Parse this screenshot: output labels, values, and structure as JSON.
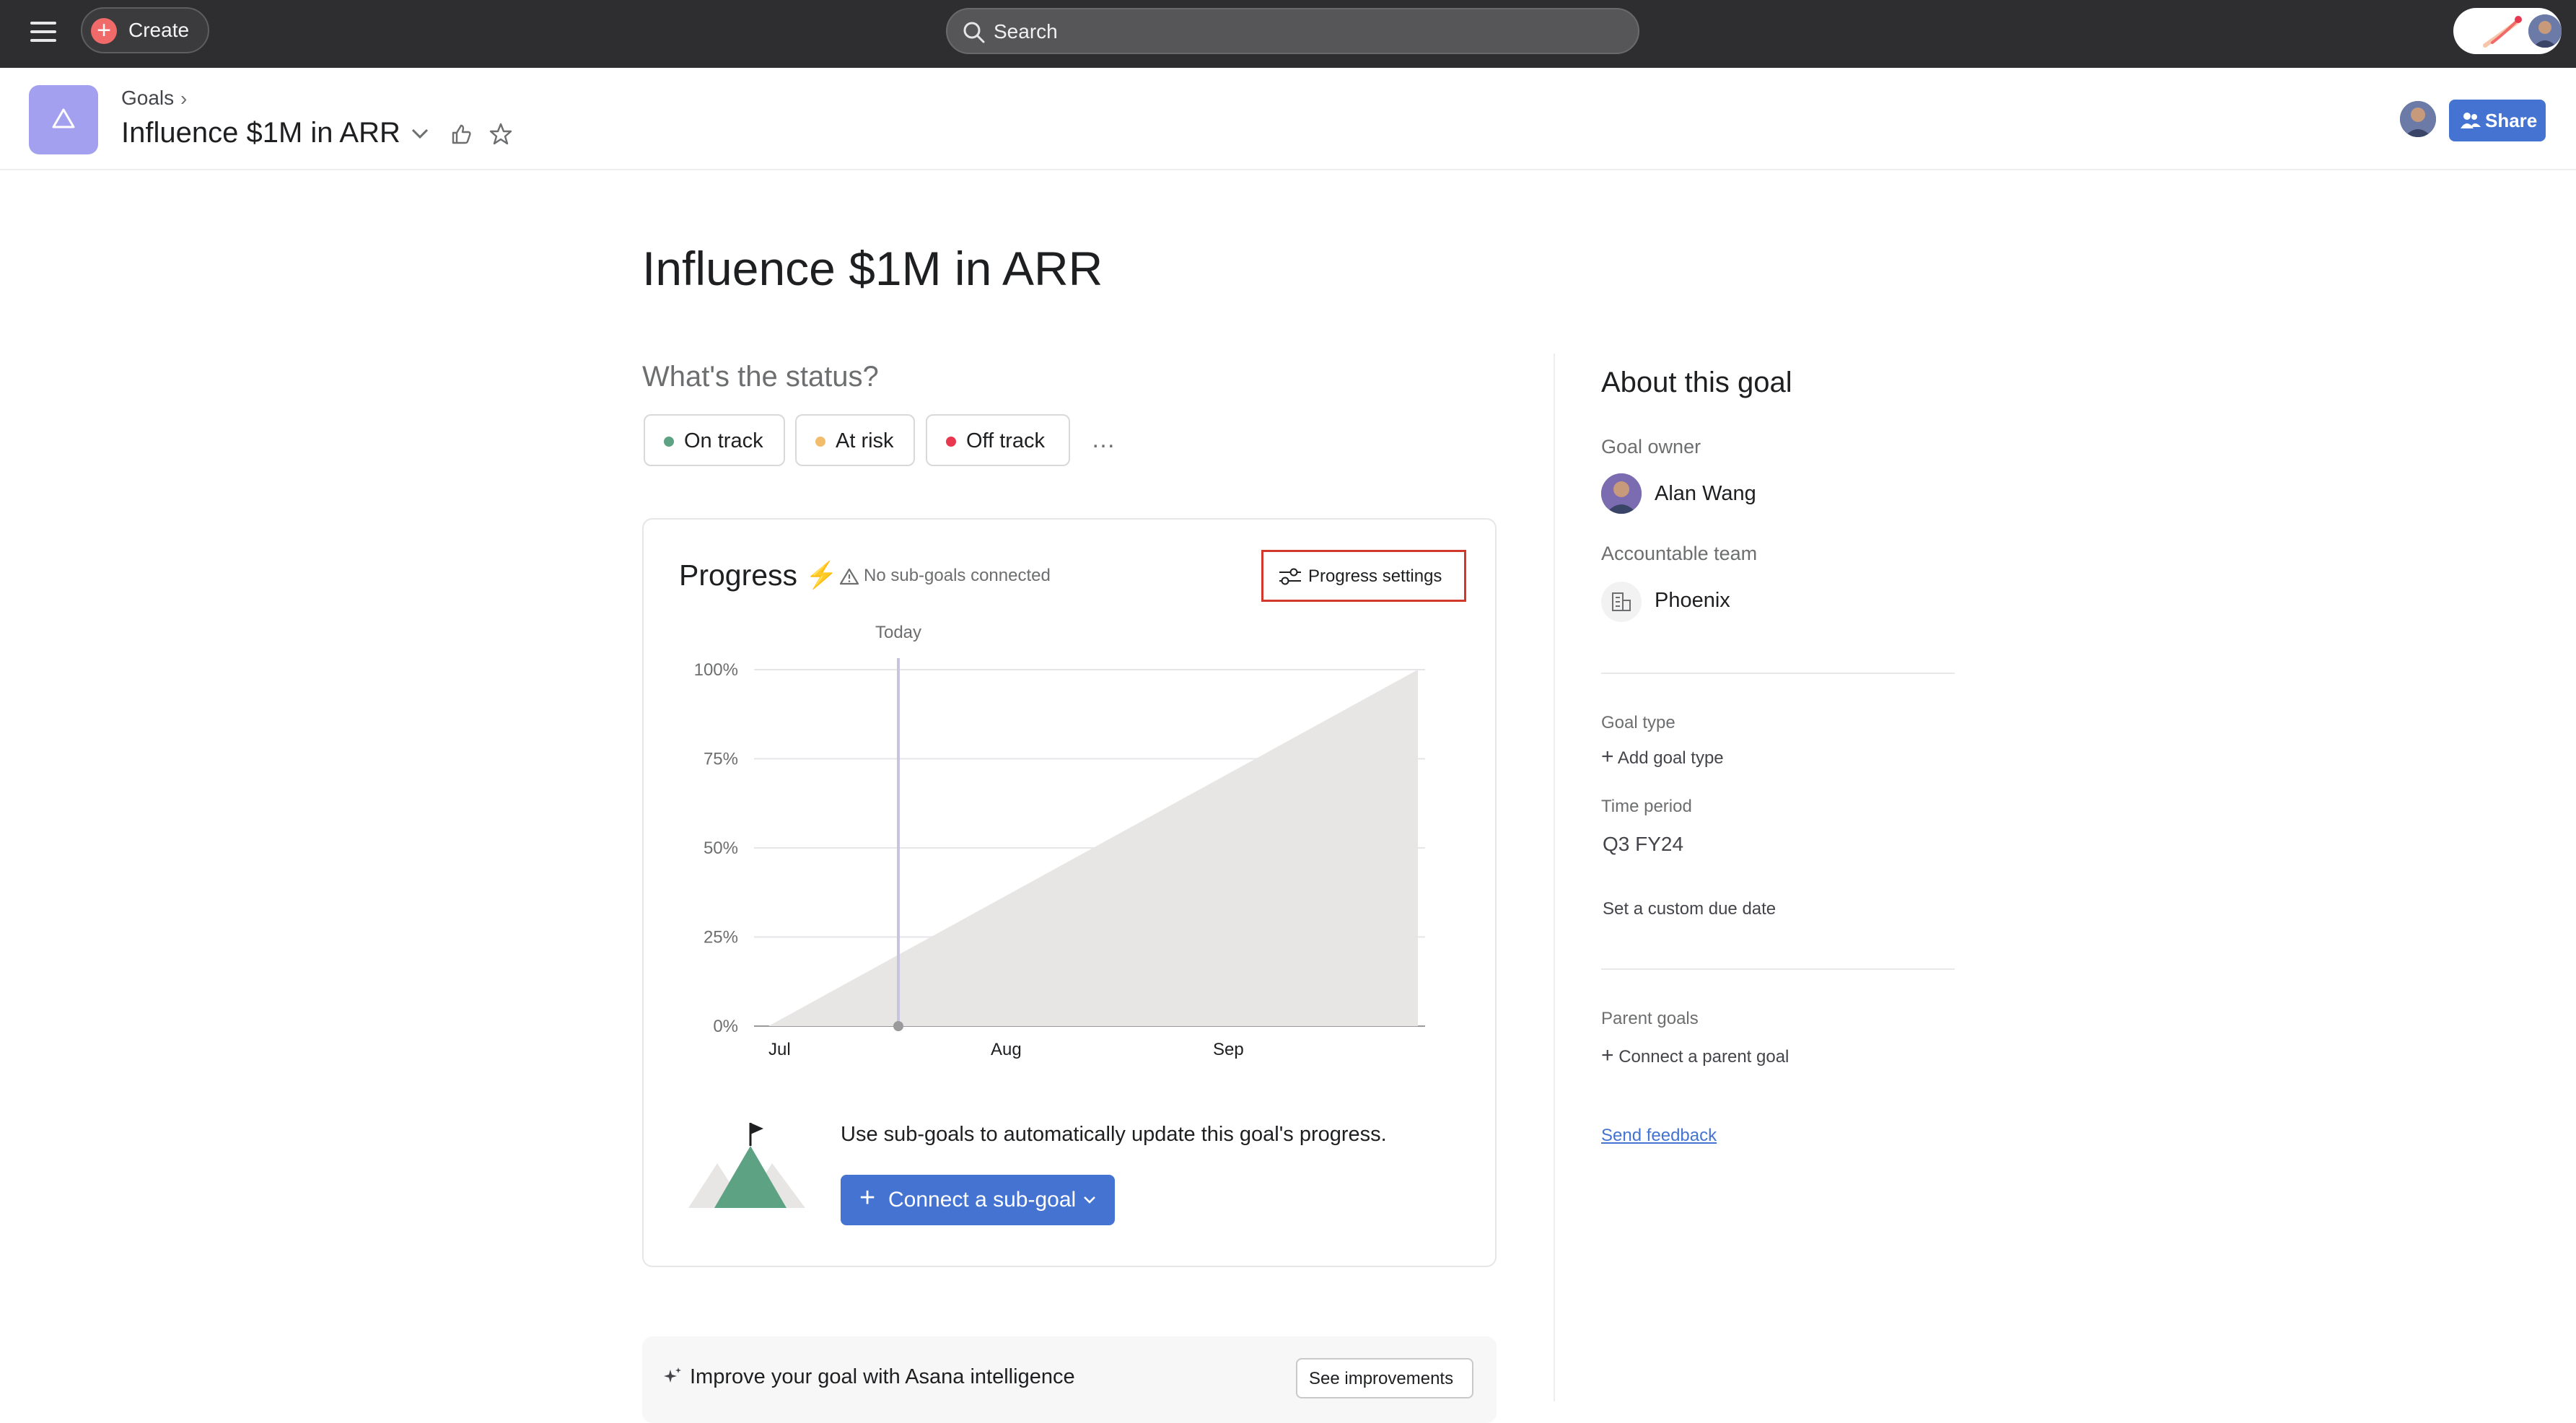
{
  "topbar": {
    "create_label": "Create",
    "search_placeholder": "Search"
  },
  "header": {
    "breadcrumb": "Goals",
    "title": "Influence $1M in ARR",
    "share_label": "Share"
  },
  "main": {
    "title": "Influence $1M in ARR",
    "status_question": "What's the status?",
    "status_options": [
      {
        "label": "On track",
        "color": "#5da283"
      },
      {
        "label": "At risk",
        "color": "#f1bd6c"
      },
      {
        "label": "Off track",
        "color": "#e8384f"
      }
    ],
    "more_label": "…"
  },
  "progress": {
    "title": "Progress",
    "no_subgoals": "No sub-goals connected",
    "settings_label": "Progress settings",
    "connect_text": "Use sub-goals to automatically update this goal's progress.",
    "connect_button": "Connect a sub-goal"
  },
  "chart_data": {
    "type": "area",
    "title": "",
    "xlabel": "",
    "ylabel": "",
    "y_ticks": [
      "100%",
      "75%",
      "50%",
      "25%",
      "0%"
    ],
    "x_ticks": [
      "Jul",
      "Aug",
      "Sep"
    ],
    "today_label": "Today",
    "ylim": [
      0,
      100
    ],
    "grid": true,
    "target_line": {
      "x": [
        0,
        1
      ],
      "y": [
        0,
        100
      ],
      "x_unit": "fraction of Q3 period"
    },
    "today_position": 0.2,
    "current_progress": 0,
    "fill_color": "#e8e6e5",
    "today_line_color": "#c7c4df"
  },
  "intelligence": {
    "label": "Improve your goal with Asana intelligence",
    "button": "See improvements"
  },
  "sidebar": {
    "about_title": "About this goal",
    "owner_label": "Goal owner",
    "owner_name": "Alan Wang",
    "team_label": "Accountable team",
    "team_name": "Phoenix",
    "goal_type_label": "Goal type",
    "add_goal_type": "Add goal type",
    "time_period_label": "Time period",
    "time_period_value": "Q3 FY24",
    "custom_due": "Set a custom due date",
    "parent_goals_label": "Parent goals",
    "connect_parent": "Connect a parent goal",
    "send_feedback": "Send feedback"
  },
  "colors": {
    "topbar": "#2e2e30",
    "accent": "#4573d2",
    "goal_icon": "#a4a0f0",
    "highlight_box": "#d1392c"
  }
}
